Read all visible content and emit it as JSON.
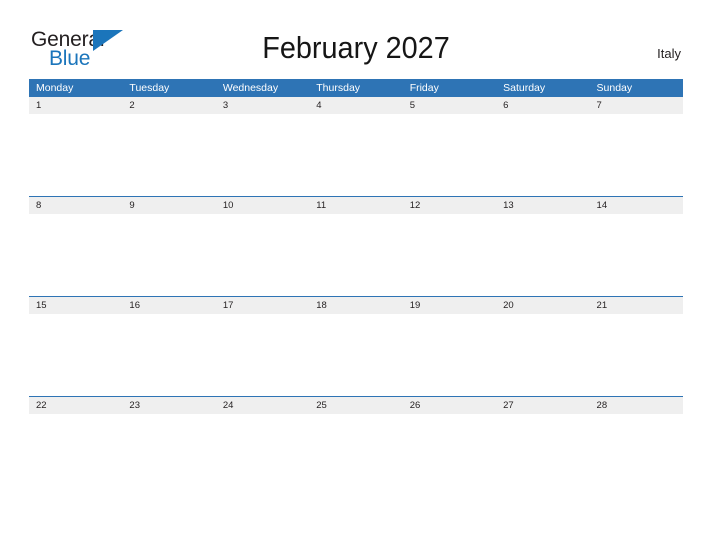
{
  "brand": {
    "name_part1": "General",
    "name_part2": "Blue",
    "flag_icon": "blue-triangle-flag-icon",
    "color_dark": "#231f20",
    "color_blue": "#1b75bb"
  },
  "header": {
    "title": "February 2027",
    "country": "Italy"
  },
  "theme": {
    "header_blue": "#2e74b5",
    "date_strip_gray": "#efefef",
    "rule_blue": "#2e74b5",
    "text_dark": "#231f20",
    "background": "#ffffff"
  },
  "calendar": {
    "month": "February",
    "year": "2027",
    "weekday_headers": [
      "Monday",
      "Tuesday",
      "Wednesday",
      "Thursday",
      "Friday",
      "Saturday",
      "Sunday"
    ],
    "weeks": [
      {
        "rule": false,
        "days": [
          "1",
          "2",
          "3",
          "4",
          "5",
          "6",
          "7"
        ]
      },
      {
        "rule": true,
        "days": [
          "8",
          "9",
          "10",
          "11",
          "12",
          "13",
          "14"
        ]
      },
      {
        "rule": true,
        "days": [
          "15",
          "16",
          "17",
          "18",
          "19",
          "20",
          "21"
        ]
      },
      {
        "rule": true,
        "days": [
          "22",
          "23",
          "24",
          "25",
          "26",
          "27",
          "28"
        ]
      }
    ]
  }
}
